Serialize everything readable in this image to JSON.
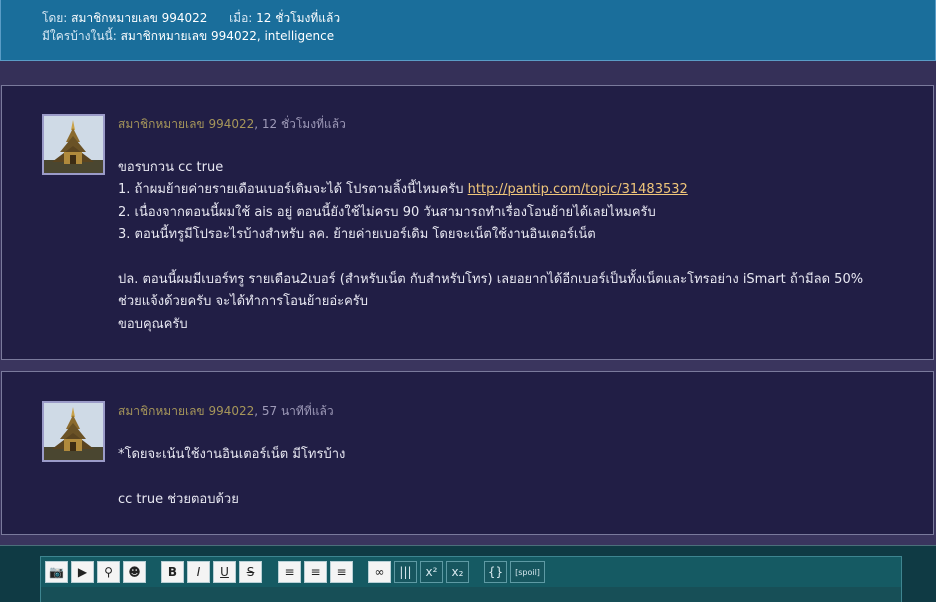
{
  "header": {
    "by_label": "โดย:",
    "by_user": "สมาชิกหมายเลข 994022",
    "when_label": "เมื่อ:",
    "when_value": "12 ชั่วโมงที่แล้ว",
    "participants_label": "มีใครบ้างในนี้:",
    "participants_value": "สมาชิกหมายเลข 994022, intelligence"
  },
  "comments": [
    {
      "user": "สมาชิกหมายเลข 994022",
      "ago": ", 12 ชั่วโมงที่แล้ว",
      "lines": [
        "ขอรบกวน cc true",
        "1. ถ้าผมย้ายค่ายรายเดือนเบอร์เดิมจะได้ โปรตามลิ้งนี้ไหมครับ ",
        "2. เนื่องจากตอนนี้ผมใช้ ais อยู่  ตอนนี้ยังใช้ไม่ครบ 90 วันสามารถทำเรื่องโอนย้ายได้เลยไหมครับ",
        "3. ตอนนี้ทรูมีโปรอะไรบ้างสำหรับ ลค. ย้ายค่ายเบอร์เดิม โดยจะเน็ตใช้งานอินเตอร์เน็ต",
        "ปล. ตอนนี้ผมมีเบอร์ทรู รายเดือน2เบอร์ (สำหรับเน็ต กับสำหรับโทร) เลยอยากได้อีกเบอร์เป็นทั้งเน็ตและโทรอย่าง iSmart ถ้ามีลด 50%",
        "ช่วยแจ้งด้วยครับ จะได้ทำการโอนย้ายอ่ะครับ",
        "ขอบคุณครับ"
      ],
      "link": "http://pantip.com/topic/31483532"
    },
    {
      "user": "สมาชิกหมายเลข 994022",
      "ago": ", 57 นาทีที่แล้ว",
      "lines": [
        "*โดยจะเน้นใช้งานอินเตอร์เน็ต มีโทรบ้าง",
        "cc true ช่วยตอบด้วย"
      ]
    }
  ],
  "toolbar": {
    "buttons": [
      {
        "icon": "camera-icon",
        "glyph": "📷"
      },
      {
        "icon": "video-icon",
        "glyph": "▶"
      },
      {
        "icon": "map-pin-icon",
        "glyph": "⚲"
      },
      {
        "icon": "emoticon-icon",
        "glyph": "☻"
      },
      {
        "icon": "bold-icon",
        "glyph": "B"
      },
      {
        "icon": "italic-icon",
        "glyph": "I"
      },
      {
        "icon": "underline-icon",
        "glyph": "U"
      },
      {
        "icon": "strikethrough-icon",
        "glyph": "S"
      },
      {
        "icon": "align-left-icon",
        "glyph": "≡"
      },
      {
        "icon": "align-center-icon",
        "glyph": "≡"
      },
      {
        "icon": "align-right-icon",
        "glyph": "≡"
      },
      {
        "icon": "link-icon",
        "glyph": "∞"
      },
      {
        "icon": "code-icon",
        "glyph": "|||"
      },
      {
        "icon": "superscript-icon",
        "glyph": "x²"
      },
      {
        "icon": "subscript-icon",
        "glyph": "x₂"
      },
      {
        "icon": "code-block-icon",
        "glyph": "{}"
      },
      {
        "icon": "spoiler-icon",
        "glyph": "[spoil]"
      }
    ]
  }
}
